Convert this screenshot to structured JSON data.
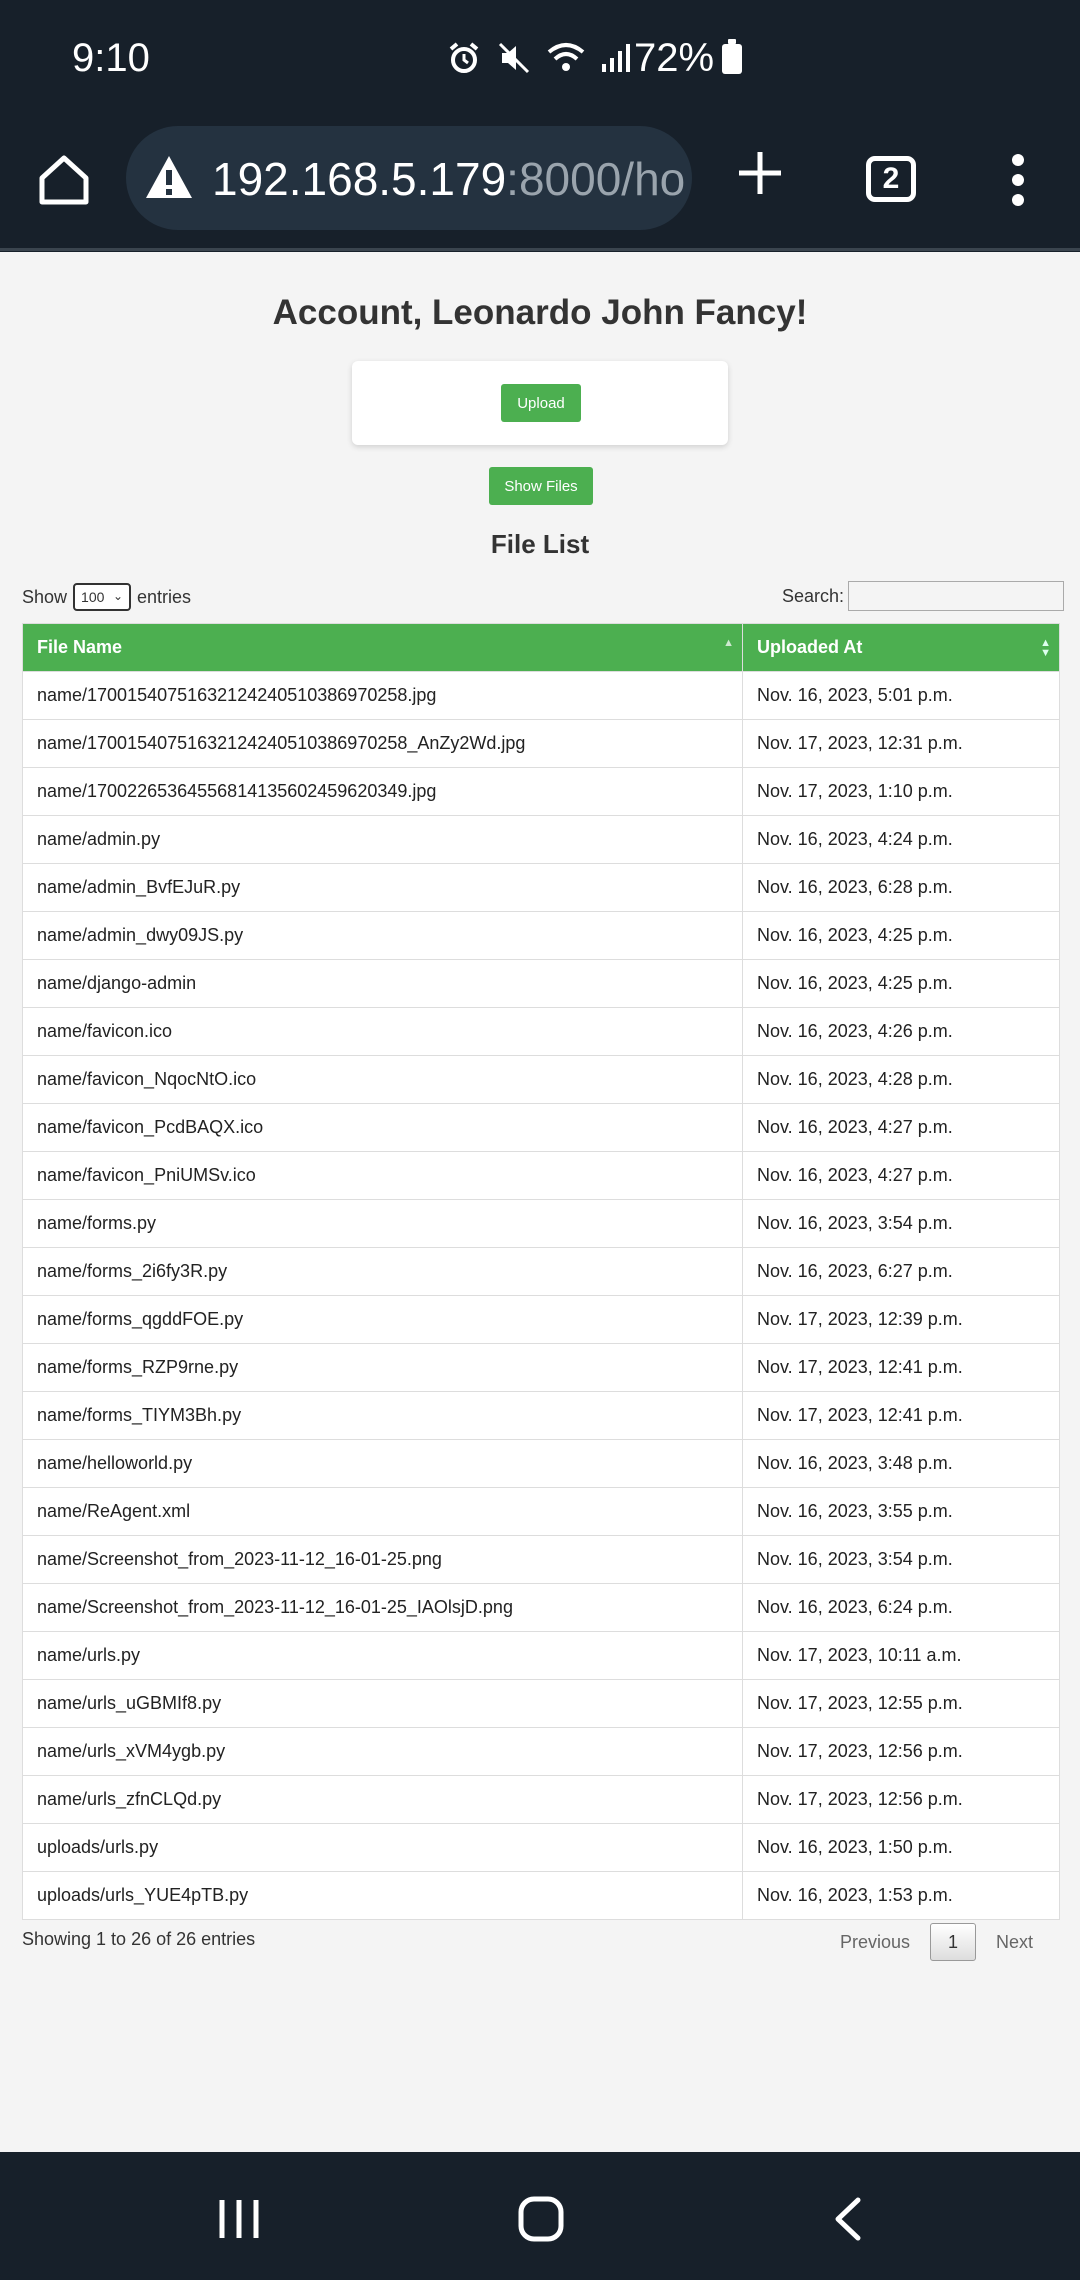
{
  "status": {
    "time": "9:10",
    "battery": "72%"
  },
  "browser": {
    "url_host": "192.168.5.179",
    "url_rest": ":8000/ho",
    "tab_count": "2"
  },
  "page": {
    "title": "Account, Leonardo John Fancy!",
    "upload_label": "Upload",
    "show_files_label": "Show Files",
    "list_title": "File List",
    "show_label": "Show",
    "entries_label": "entries",
    "length_value": "100",
    "search_label": "Search:",
    "search_value": ""
  },
  "table": {
    "headers": [
      "File Name",
      "Uploaded At"
    ],
    "rows": [
      [
        "name/17001540751632124240510386970258.jpg",
        "Nov. 16, 2023, 5:01 p.m."
      ],
      [
        "name/17001540751632124240510386970258_AnZy2Wd.jpg",
        "Nov. 17, 2023, 12:31 p.m."
      ],
      [
        "name/17002265364556814135602459620349.jpg",
        "Nov. 17, 2023, 1:10 p.m."
      ],
      [
        "name/admin.py",
        "Nov. 16, 2023, 4:24 p.m."
      ],
      [
        "name/admin_BvfEJuR.py",
        "Nov. 16, 2023, 6:28 p.m."
      ],
      [
        "name/admin_dwy09JS.py",
        "Nov. 16, 2023, 4:25 p.m."
      ],
      [
        "name/django-admin",
        "Nov. 16, 2023, 4:25 p.m."
      ],
      [
        "name/favicon.ico",
        "Nov. 16, 2023, 4:26 p.m."
      ],
      [
        "name/favicon_NqocNtO.ico",
        "Nov. 16, 2023, 4:28 p.m."
      ],
      [
        "name/favicon_PcdBAQX.ico",
        "Nov. 16, 2023, 4:27 p.m."
      ],
      [
        "name/favicon_PniUMSv.ico",
        "Nov. 16, 2023, 4:27 p.m."
      ],
      [
        "name/forms.py",
        "Nov. 16, 2023, 3:54 p.m."
      ],
      [
        "name/forms_2i6fy3R.py",
        "Nov. 16, 2023, 6:27 p.m."
      ],
      [
        "name/forms_qgddFOE.py",
        "Nov. 17, 2023, 12:39 p.m."
      ],
      [
        "name/forms_RZP9rne.py",
        "Nov. 17, 2023, 12:41 p.m."
      ],
      [
        "name/forms_TIYM3Bh.py",
        "Nov. 17, 2023, 12:41 p.m."
      ],
      [
        "name/helloworld.py",
        "Nov. 16, 2023, 3:48 p.m."
      ],
      [
        "name/ReAgent.xml",
        "Nov. 16, 2023, 3:55 p.m."
      ],
      [
        "name/Screenshot_from_2023-11-12_16-01-25.png",
        "Nov. 16, 2023, 3:54 p.m."
      ],
      [
        "name/Screenshot_from_2023-11-12_16-01-25_IAOlsjD.png",
        "Nov. 16, 2023, 6:24 p.m."
      ],
      [
        "name/urls.py",
        "Nov. 17, 2023, 10:11 a.m."
      ],
      [
        "name/urls_uGBMIf8.py",
        "Nov. 17, 2023, 12:55 p.m."
      ],
      [
        "name/urls_xVM4ygb.py",
        "Nov. 17, 2023, 12:56 p.m."
      ],
      [
        "name/urls_zfnCLQd.py",
        "Nov. 17, 2023, 12:56 p.m."
      ],
      [
        "uploads/urls.py",
        "Nov. 16, 2023, 1:50 p.m."
      ],
      [
        "uploads/urls_YUE4pTB.py",
        "Nov. 16, 2023, 1:53 p.m."
      ]
    ]
  },
  "footer": {
    "info": "Showing 1 to 26 of 26 entries",
    "previous": "Previous",
    "current_page": "1",
    "next": "Next"
  },
  "colors": {
    "accent": "#4caf50",
    "chrome": "#17202a"
  }
}
